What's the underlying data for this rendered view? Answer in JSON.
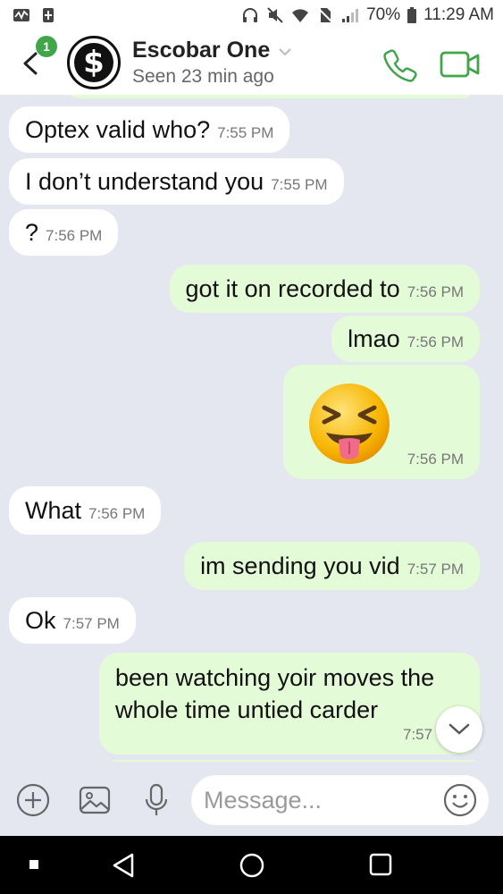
{
  "status_bar": {
    "battery": "70%",
    "time": "11:29 AM"
  },
  "header": {
    "unread_count": "1",
    "contact_name": "Escobar One",
    "contact_status": "Seen 23 min ago",
    "avatar_symbol": "$"
  },
  "messages": [
    {
      "dir": "in",
      "text": "Optex valid who?",
      "time": "7:55 PM"
    },
    {
      "dir": "in",
      "text": "I don’t understand you",
      "time": "7:55 PM"
    },
    {
      "dir": "in",
      "text": "?",
      "time": "7:56 PM"
    },
    {
      "dir": "out",
      "text": "got it on recorded to",
      "time": "7:56 PM"
    },
    {
      "dir": "out",
      "text": "lmao",
      "time": "7:56 PM"
    },
    {
      "dir": "out",
      "emoji": "squinting-face-with-tongue",
      "time": "7:56 PM"
    },
    {
      "dir": "in",
      "text": "What",
      "time": "7:56 PM"
    },
    {
      "dir": "out",
      "text": "im sending you vid",
      "time": "7:57 PM"
    },
    {
      "dir": "in",
      "text": "Ok",
      "time": "7:57 PM"
    },
    {
      "dir": "out",
      "text_line1": "been watching yoir moves the",
      "text_line2": "whole time untied carder",
      "time": "7:57"
    }
  ],
  "composer": {
    "placeholder": "Message..."
  },
  "colors": {
    "background": "#e4e7ef",
    "outgoing_bubble": "#e4fbd7",
    "incoming_bubble": "#ffffff",
    "accent_green": "#41a54a"
  }
}
